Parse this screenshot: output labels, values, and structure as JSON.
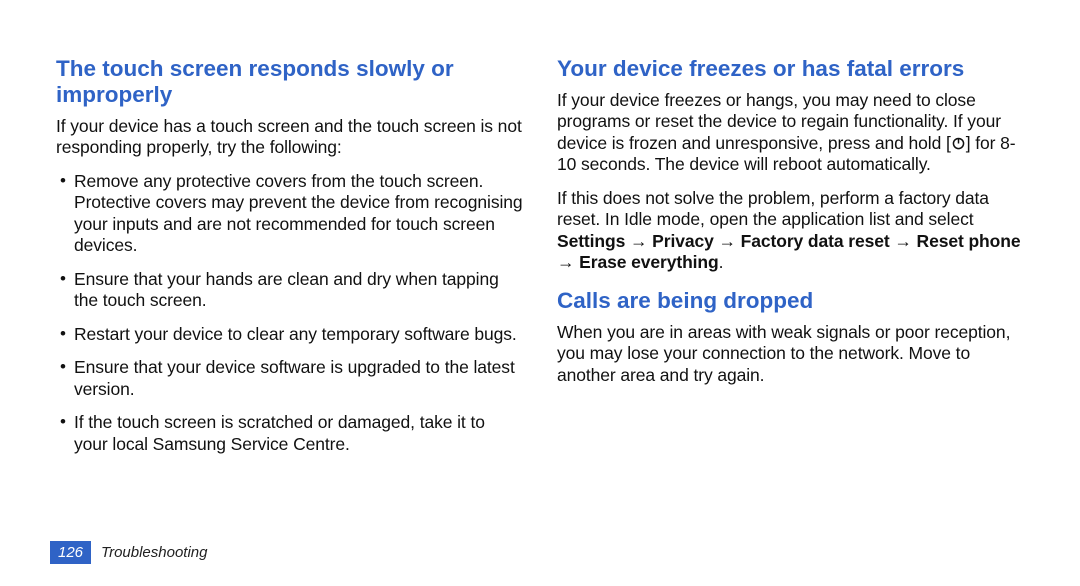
{
  "left": {
    "heading": "The touch screen responds slowly or improperly",
    "intro": "If your device has a touch screen and the touch screen is not responding properly, try the following:",
    "bullets": [
      "Remove any protective covers from the touch screen. Protective covers may prevent the device from recognising your inputs and are not recommended for touch screen devices.",
      "Ensure that your hands are clean and dry when tapping the touch screen.",
      "Restart your device to clear any temporary software bugs.",
      "Ensure that your device software is upgraded to the latest version.",
      "If the touch screen is scratched or damaged, take it to your local Samsung Service Centre."
    ]
  },
  "right": {
    "sec1": {
      "heading": "Your device freezes or has fatal errors",
      "para1_pre": "If your device freezes or hangs, you may need to close programs or reset the device to regain functionality. If your device is frozen and unresponsive, press and hold [",
      "power_icon_name": "power-icon",
      "para1_post": "] for 8-10 seconds. The device will reboot automatically.",
      "para2_pre": "If this does not solve the problem, perform a factory data reset. In Idle mode, open the application list and select ",
      "para2_bold": "Settings → Privacy → Factory data reset → Reset phone → Erase everything",
      "para2_post": "."
    },
    "sec2": {
      "heading": "Calls are being dropped",
      "para": "When you are in areas with weak signals or poor reception, you may lose your connection to the network. Move to another area and try again."
    }
  },
  "footer": {
    "page_number": "126",
    "section": "Troubleshooting"
  }
}
